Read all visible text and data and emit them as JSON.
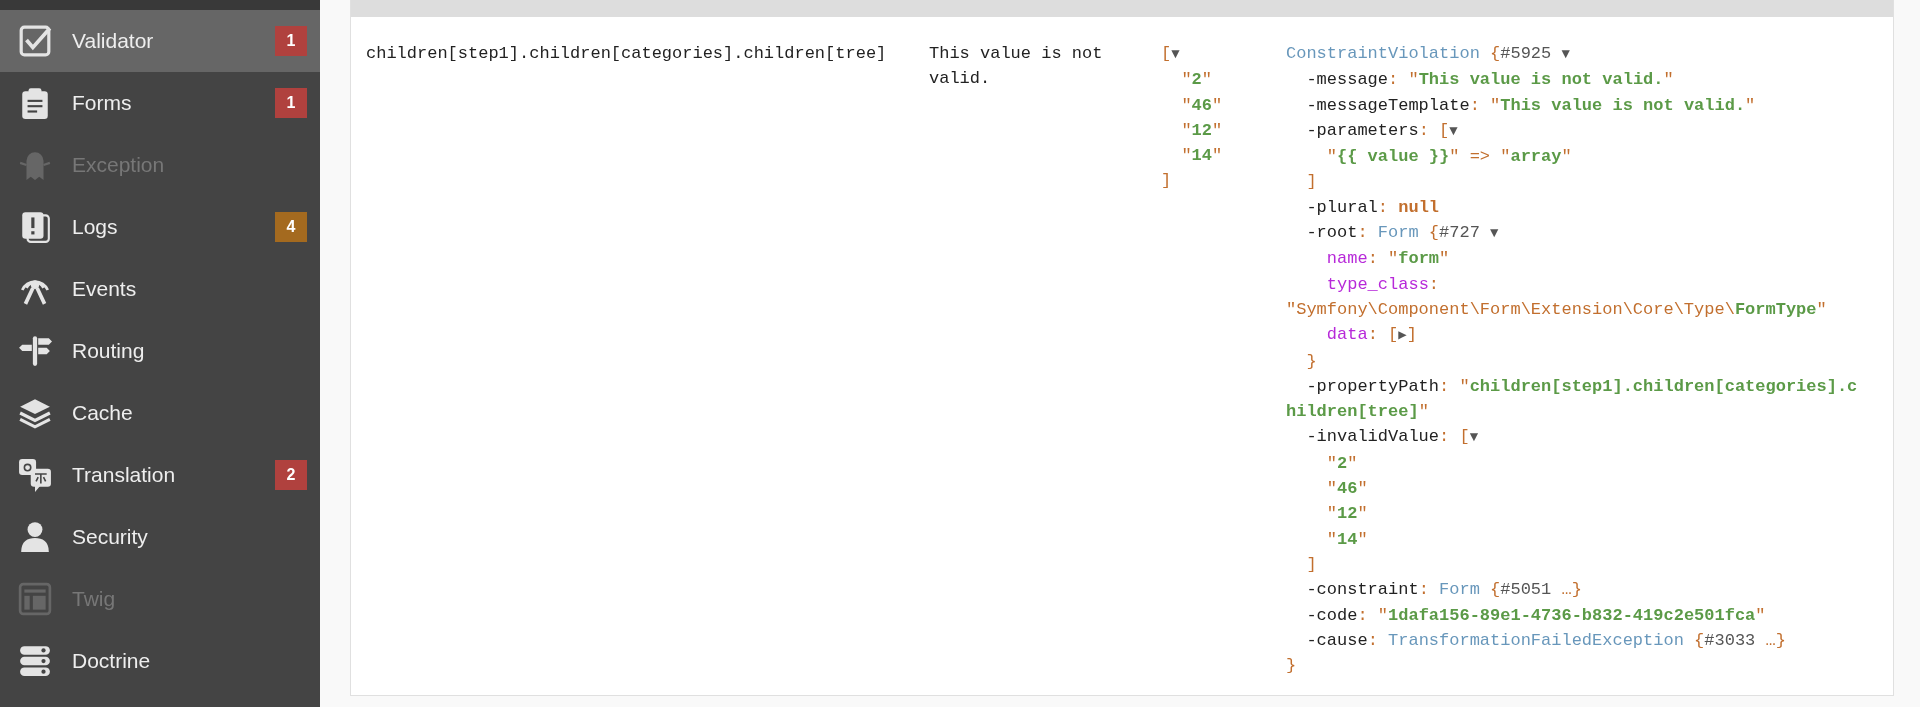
{
  "sidebar": {
    "items": [
      {
        "label": "Validator",
        "selected": true,
        "disabled": false,
        "badge": "1",
        "color": "#b0413e"
      },
      {
        "label": "Forms",
        "selected": false,
        "disabled": false,
        "badge": "1",
        "color": "#b0413e"
      },
      {
        "label": "Exception",
        "selected": false,
        "disabled": true
      },
      {
        "label": "Logs",
        "selected": false,
        "disabled": false,
        "badge": "4",
        "color": "#a46a1f"
      },
      {
        "label": "Events",
        "selected": false,
        "disabled": false
      },
      {
        "label": "Routing",
        "selected": false,
        "disabled": false
      },
      {
        "label": "Cache",
        "selected": false,
        "disabled": false
      },
      {
        "label": "Translation",
        "selected": false,
        "disabled": false,
        "badge": "2",
        "color": "#b0413e"
      },
      {
        "label": "Security",
        "selected": false,
        "disabled": false
      },
      {
        "label": "Twig",
        "selected": false,
        "disabled": true
      },
      {
        "label": "Doctrine",
        "selected": false,
        "disabled": false
      }
    ]
  },
  "table": {
    "rows": [
      {
        "path": "children[step1].children[categories].children[tree]",
        "message": "This value is not valid.",
        "invalid_value": [
          {
            "tokens": [
              {
                "kind": "punct",
                "text": "["
              },
              {
                "kind": "toggle",
                "text": "▼"
              }
            ],
            "children": [
              {
                "tokens": [
                  {
                    "kind": "punct",
                    "text": "\""
                  },
                  {
                    "kind": "str",
                    "text": "2"
                  },
                  {
                    "kind": "punct",
                    "text": "\""
                  }
                ]
              },
              {
                "tokens": [
                  {
                    "kind": "punct",
                    "text": "\""
                  },
                  {
                    "kind": "str",
                    "text": "46"
                  },
                  {
                    "kind": "punct",
                    "text": "\""
                  }
                ]
              },
              {
                "tokens": [
                  {
                    "kind": "punct",
                    "text": "\""
                  },
                  {
                    "kind": "str",
                    "text": "12"
                  },
                  {
                    "kind": "punct",
                    "text": "\""
                  }
                ]
              },
              {
                "tokens": [
                  {
                    "kind": "punct",
                    "text": "\""
                  },
                  {
                    "kind": "str",
                    "text": "14"
                  },
                  {
                    "kind": "punct",
                    "text": "\""
                  }
                ]
              }
            ]
          },
          {
            "tokens": [
              {
                "kind": "punct",
                "text": "]"
              }
            ]
          }
        ],
        "violation": [
          {
            "tokens": [
              {
                "kind": "note",
                "text": "ConstraintViolation"
              },
              {
                "kind": "punct",
                "text": " {"
              },
              {
                "kind": "ref",
                "text": "#5925 "
              },
              {
                "kind": "toggle",
                "text": "▼"
              }
            ],
            "children": [
              {
                "tokens": [
                  {
                    "kind": "protected",
                    "text": "-message"
                  },
                  {
                    "kind": "punct",
                    "text": ": \""
                  },
                  {
                    "kind": "str",
                    "text": "This value is not valid."
                  },
                  {
                    "kind": "punct",
                    "text": "\""
                  }
                ]
              },
              {
                "tokens": [
                  {
                    "kind": "protected",
                    "text": "-messageTemplate"
                  },
                  {
                    "kind": "punct",
                    "text": ": \""
                  },
                  {
                    "kind": "str",
                    "text": "This value is not valid."
                  },
                  {
                    "kind": "punct",
                    "text": "\""
                  }
                ]
              },
              {
                "tokens": [
                  {
                    "kind": "protected",
                    "text": "-parameters"
                  },
                  {
                    "kind": "punct",
                    "text": ": ["
                  },
                  {
                    "kind": "toggle",
                    "text": "▼"
                  }
                ],
                "children": [
                  {
                    "tokens": [
                      {
                        "kind": "punct",
                        "text": "\""
                      },
                      {
                        "kind": "str",
                        "text": "{{ value }}"
                      },
                      {
                        "kind": "punct",
                        "text": "\" => \""
                      },
                      {
                        "kind": "str",
                        "text": "array"
                      },
                      {
                        "kind": "punct",
                        "text": "\""
                      }
                    ]
                  }
                ]
              },
              {
                "tokens": [
                  {
                    "kind": "punct",
                    "text": "]"
                  }
                ]
              },
              {
                "tokens": [
                  {
                    "kind": "protected",
                    "text": "-plural"
                  },
                  {
                    "kind": "punct",
                    "text": ": "
                  },
                  {
                    "kind": "const",
                    "text": "null"
                  }
                ]
              },
              {
                "tokens": [
                  {
                    "kind": "protected",
                    "text": "-root"
                  },
                  {
                    "kind": "punct",
                    "text": ": "
                  },
                  {
                    "kind": "note",
                    "text": "Form"
                  },
                  {
                    "kind": "punct",
                    "text": " {"
                  },
                  {
                    "kind": "ref",
                    "text": "#727 "
                  },
                  {
                    "kind": "toggle",
                    "text": "▼"
                  }
                ],
                "children": [
                  {
                    "tokens": [
                      {
                        "kind": "public",
                        "text": "name"
                      },
                      {
                        "kind": "punct",
                        "text": ": \""
                      },
                      {
                        "kind": "str",
                        "text": "form"
                      },
                      {
                        "kind": "punct",
                        "text": "\""
                      }
                    ]
                  },
                  {
                    "tokens": [
                      {
                        "kind": "public",
                        "text": "type_class"
                      },
                      {
                        "kind": "punct",
                        "text": ": "
                      },
                      {
                        "kind": "punct",
                        "text": "\"Symfony\\Component\\Form\\Extension\\Core\\Type\\"
                      },
                      {
                        "kind": "str",
                        "text": "FormType"
                      },
                      {
                        "kind": "punct",
                        "text": "\""
                      }
                    ]
                  },
                  {
                    "tokens": [
                      {
                        "kind": "public",
                        "text": "data"
                      },
                      {
                        "kind": "punct",
                        "text": ": ["
                      },
                      {
                        "kind": "toggle",
                        "text": "▶"
                      },
                      {
                        "kind": "punct",
                        "text": "]"
                      }
                    ]
                  }
                ]
              },
              {
                "tokens": [
                  {
                    "kind": "punct",
                    "text": "}"
                  }
                ]
              },
              {
                "tokens": [
                  {
                    "kind": "protected",
                    "text": "-propertyPath"
                  },
                  {
                    "kind": "punct",
                    "text": ": \""
                  },
                  {
                    "kind": "str",
                    "text": "children[step1].children[categories].children[tree]"
                  },
                  {
                    "kind": "punct",
                    "text": "\""
                  }
                ]
              },
              {
                "tokens": [
                  {
                    "kind": "protected",
                    "text": "-invalidValue"
                  },
                  {
                    "kind": "punct",
                    "text": ": ["
                  },
                  {
                    "kind": "toggle",
                    "text": "▼"
                  }
                ],
                "children": [
                  {
                    "tokens": [
                      {
                        "kind": "punct",
                        "text": "\""
                      },
                      {
                        "kind": "str",
                        "text": "2"
                      },
                      {
                        "kind": "punct",
                        "text": "\""
                      }
                    ]
                  },
                  {
                    "tokens": [
                      {
                        "kind": "punct",
                        "text": "\""
                      },
                      {
                        "kind": "str",
                        "text": "46"
                      },
                      {
                        "kind": "punct",
                        "text": "\""
                      }
                    ]
                  },
                  {
                    "tokens": [
                      {
                        "kind": "punct",
                        "text": "\""
                      },
                      {
                        "kind": "str",
                        "text": "12"
                      },
                      {
                        "kind": "punct",
                        "text": "\""
                      }
                    ]
                  },
                  {
                    "tokens": [
                      {
                        "kind": "punct",
                        "text": "\""
                      },
                      {
                        "kind": "str",
                        "text": "14"
                      },
                      {
                        "kind": "punct",
                        "text": "\""
                      }
                    ]
                  }
                ]
              },
              {
                "tokens": [
                  {
                    "kind": "punct",
                    "text": "]"
                  }
                ]
              },
              {
                "tokens": [
                  {
                    "kind": "protected",
                    "text": "-constraint"
                  },
                  {
                    "kind": "punct",
                    "text": ": "
                  },
                  {
                    "kind": "note",
                    "text": "Form"
                  },
                  {
                    "kind": "punct",
                    "text": " {"
                  },
                  {
                    "kind": "ref",
                    "text": "#5051 "
                  },
                  {
                    "kind": "punct",
                    "text": "…}"
                  }
                ]
              },
              {
                "tokens": [
                  {
                    "kind": "protected",
                    "text": "-code"
                  },
                  {
                    "kind": "punct",
                    "text": ": \""
                  },
                  {
                    "kind": "str",
                    "text": "1dafa156-89e1-4736-b832-419c2e501fca"
                  },
                  {
                    "kind": "punct",
                    "text": "\""
                  }
                ]
              },
              {
                "tokens": [
                  {
                    "kind": "protected",
                    "text": "-cause"
                  },
                  {
                    "kind": "punct",
                    "text": ": "
                  },
                  {
                    "kind": "note",
                    "text": "TransformationFailedException"
                  },
                  {
                    "kind": "punct",
                    "text": " {"
                  },
                  {
                    "kind": "ref",
                    "text": "#3033 "
                  },
                  {
                    "kind": "punct",
                    "text": "…}"
                  }
                ]
              }
            ]
          },
          {
            "tokens": [
              {
                "kind": "punct",
                "text": "}"
              }
            ]
          }
        ]
      }
    ]
  }
}
